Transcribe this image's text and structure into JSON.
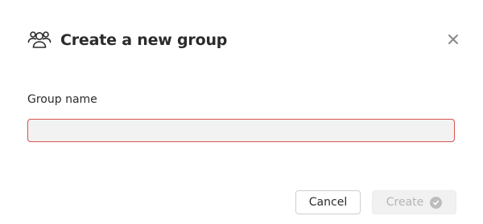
{
  "dialog": {
    "title": "Create a new group",
    "title_icon": "group-icon",
    "close_icon": "close-icon"
  },
  "form": {
    "group_name_label": "Group name",
    "group_name_value": "",
    "group_name_placeholder": ""
  },
  "footer": {
    "cancel_label": "Cancel",
    "create_label": "Create",
    "create_icon": "check-circle-icon"
  },
  "colors": {
    "input_error_border": "#d9534f",
    "input_background": "#f2f2f2",
    "disabled_button_bg": "#f1f1f1"
  }
}
